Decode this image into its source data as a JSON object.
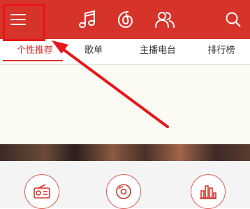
{
  "tabs": [
    {
      "label": "个性推荐",
      "active": true
    },
    {
      "label": "歌单",
      "active": false
    },
    {
      "label": "主播电台",
      "active": false
    },
    {
      "label": "排行榜",
      "active": false
    }
  ],
  "icons": {
    "menu": "menu-icon",
    "music": "music-note-icon",
    "discover": "netease-logo-icon",
    "friends": "friends-icon",
    "search": "search-icon",
    "fm": "private-fm-icon",
    "daily": "daily-recommend-icon",
    "chart": "chart-icon"
  },
  "colors": {
    "topbar": "#d6332b",
    "accent": "#d6332b",
    "annotation": "#e8161b"
  }
}
